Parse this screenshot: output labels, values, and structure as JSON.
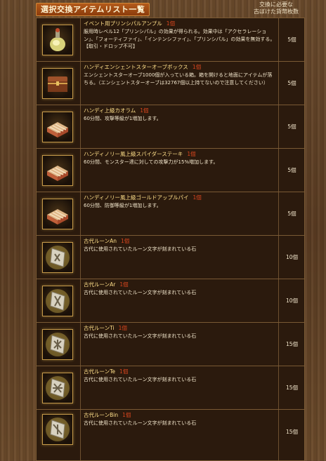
{
  "header": {
    "title": "選択交換アイテムリスト一覧",
    "note_line1": "交換に必要な",
    "note_line2": "古ぼけた貨幣枚数"
  },
  "items": [
    {
      "icon": "potion-bottle-icon",
      "name": "イベント用プリンシパルアンプル",
      "qty": "1個",
      "desc": "服用時レベル12「プリンシパル」の効果が得られる。効果中は「アクセラレーション」、「フォーティファイ」、「インテンシファイ」、「プリンシパル」の効果を無効する。【取引・ドロップ不可】",
      "count": "5個"
    },
    {
      "icon": "treasure-chest-icon",
      "name": "ハンディエンシェントスターオーブボックス",
      "qty": "1個",
      "desc": "エンシェントスターオーブ1000個が入っている箱。箱を開けると地面にアイテムが落ちる。（エンシェントスターオーブは32767個以上持てないので注意してください）",
      "count": "5個"
    },
    {
      "icon": "food-box-icon",
      "name": "ハンディ上級カオラム",
      "qty": "1個",
      "desc": "60分間、攻撃等級が1増加します。",
      "count": "5個"
    },
    {
      "icon": "food-box-icon",
      "name": "ハンディノリー風上級スパイダーステーキ",
      "qty": "1個",
      "desc": "60分間、モンスター達に対しての攻撃力が15%増加します。",
      "count": "5個"
    },
    {
      "icon": "food-box-icon",
      "name": "ハンディノリー風上級ゴールドアップルパイ",
      "qty": "1個",
      "desc": "60分間、防御等級が1増加します。",
      "count": "5個"
    },
    {
      "icon": "rune-stone-icon",
      "name": "古代ルーンAn",
      "qty": "1個",
      "desc": "古代に使用されていたルーン文字が刻まれている石",
      "count": "10個"
    },
    {
      "icon": "rune-stone-icon",
      "name": "古代ルーンAr",
      "qty": "1個",
      "desc": "古代に使用されていたルーン文字が刻まれている石",
      "count": "10個"
    },
    {
      "icon": "rune-stone-icon",
      "name": "古代ルーンTi",
      "qty": "1個",
      "desc": "古代に使用されていたルーン文字が刻まれている石",
      "count": "15個"
    },
    {
      "icon": "rune-stone-icon",
      "name": "古代ルーンTe",
      "qty": "1個",
      "desc": "古代に使用されていたルーン文字が刻まれている石",
      "count": "15個"
    },
    {
      "icon": "rune-stone-icon",
      "name": "古代ルーンBin",
      "qty": "1個",
      "desc": "古代に使用されていたルーン文字が刻まれている石",
      "count": "15個"
    }
  ]
}
